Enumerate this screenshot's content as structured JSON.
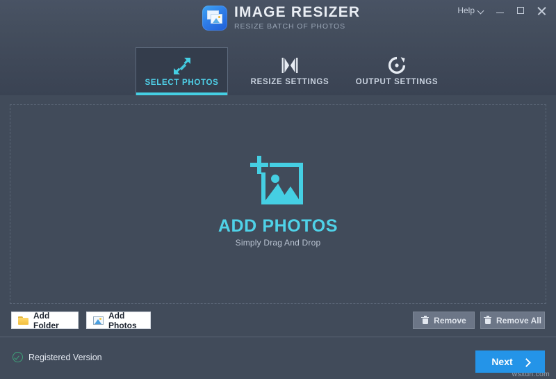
{
  "window": {
    "help_label": "Help",
    "minimize_icon": "minimize-icon",
    "maximize_icon": "maximize-icon",
    "close_icon": "close-icon"
  },
  "brand": {
    "logo_icon": "image-stack-icon",
    "title": "IMAGE RESIZER",
    "subtitle": "RESIZE BATCH OF PHOTOS"
  },
  "tabs": [
    {
      "label": "SELECT PHOTOS",
      "icon": "expand-arrows-icon",
      "active": true
    },
    {
      "label": "RESIZE SETTINGS",
      "icon": "collapse-arrows-icon",
      "active": false
    },
    {
      "label": "OUTPUT SETTINGS",
      "icon": "refresh-circle-icon",
      "active": false
    }
  ],
  "dropzone": {
    "icon": "add-photo-icon",
    "title": "ADD PHOTOS",
    "subtitle": "Simply Drag And Drop"
  },
  "actions": {
    "add_folder": {
      "label": "Add Folder",
      "icon": "folder-icon"
    },
    "add_photos": {
      "label": "Add Photos",
      "icon": "photo-icon"
    },
    "remove": {
      "label": "Remove",
      "icon": "trash-icon"
    },
    "remove_all": {
      "label": "Remove All",
      "icon": "trash-icon"
    }
  },
  "footer": {
    "status_icon": "check-circle-icon",
    "status_label": "Registered Version",
    "next_label": "Next",
    "next_icon": "chevron-right-icon",
    "watermark": "wsxdn.com"
  },
  "colors": {
    "accent_cyan": "#4fd2e8",
    "accent_blue": "#2494e8",
    "bg_body": "#414b5a",
    "bg_tab_active": "#343d4c",
    "status_green": "#3fa37a"
  }
}
